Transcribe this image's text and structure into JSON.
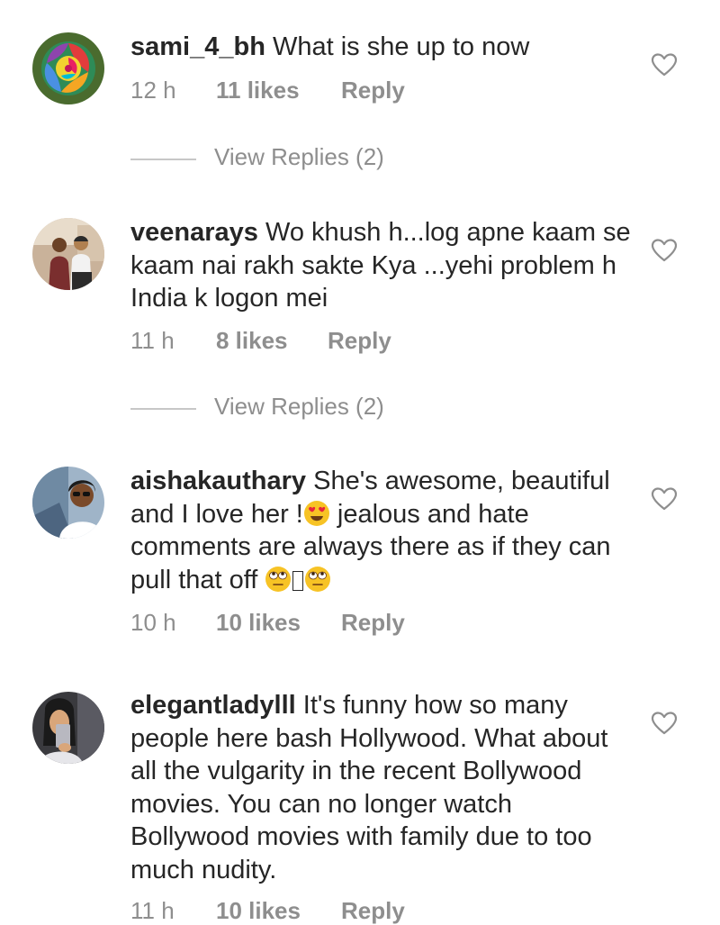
{
  "comments": [
    {
      "username": "sami_4_bh",
      "text": "What is she up to now",
      "time": "12 h",
      "likes": "11 likes",
      "reply": "Reply",
      "avatar": "rainbow-rose-icon",
      "view_replies": "View Replies (2)"
    },
    {
      "username": "veenarays",
      "text": "Wo khush h...log apne kaam se kaam nai rakh sakte Kya ...yehi problem h India k logon mei",
      "time": "11 h",
      "likes": "8 likes",
      "reply": "Reply",
      "avatar": "couple-photo-avatar",
      "view_replies": "View Replies (2)"
    },
    {
      "username": "aishakauthary",
      "text_part1": "She's awesome, beautiful and I love her !",
      "text_part2": " jealous and hate comments are always there as if they can pull that off ",
      "emoji_heart_eyes": "smiling-face-with-heart-eyes-icon",
      "emoji_eye_roll": "face-with-rolling-eyes-icon",
      "time": "10 h",
      "likes": "10 likes",
      "reply": "Reply",
      "avatar": "woman-selfie-avatar"
    },
    {
      "username": "elegantladylll",
      "text": "It's funny how so many people here bash  Hollywood.  What about all the vulgarity in the recent Bollywood movies.  You can no longer watch Bollywood movies with family due to too much nudity.",
      "time": "11 h",
      "likes": "10 likes",
      "reply": "Reply",
      "avatar": "mirror-selfie-avatar"
    }
  ],
  "colors": {
    "text": "#262626",
    "secondary": "#8e8e8e",
    "divider": "#c7c7c7"
  }
}
